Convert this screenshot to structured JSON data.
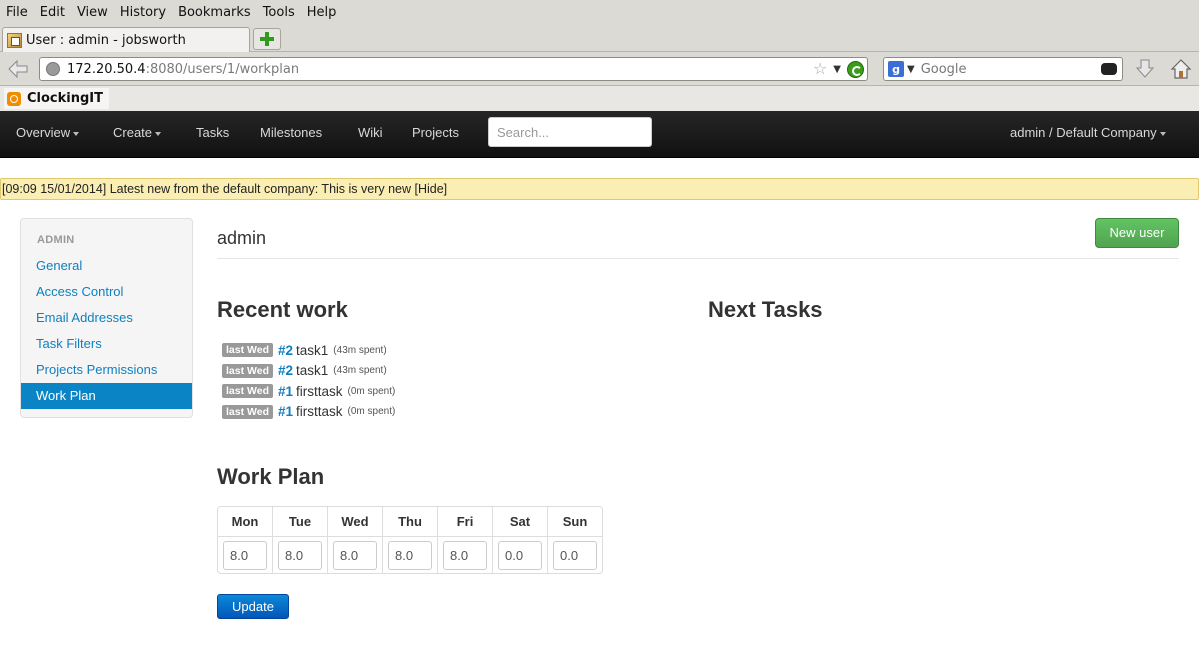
{
  "browser": {
    "menu": [
      "File",
      "Edit",
      "View",
      "History",
      "Bookmarks",
      "Tools",
      "Help"
    ],
    "tab_title": "User : admin - jobsworth",
    "url_host": "172.20.50.4",
    "url_rest": ":8080/users/1/workplan",
    "search_placeholder": "Google",
    "bookmark": "ClockingIT"
  },
  "nav": {
    "items": [
      "Overview",
      "Create",
      "Tasks",
      "Milestones",
      "Wiki",
      "Projects"
    ],
    "search_placeholder": "Search...",
    "user_menu": "admin / Default Company"
  },
  "notice": "[09:09 15/01/2014] Latest new from the default company: This is very new [Hide]",
  "sidebar": {
    "header": "ADMIN",
    "items": [
      "General",
      "Access Control",
      "Email Addresses",
      "Task Filters",
      "Projects Permissions",
      "Work Plan"
    ],
    "active": "Work Plan"
  },
  "page": {
    "title": "admin",
    "new_user_label": "New user",
    "recent_work_heading": "Recent work",
    "next_tasks_heading": "Next Tasks",
    "work_plan_heading": "Work Plan",
    "update_label": "Update"
  },
  "recent_work": [
    {
      "when": "last Wed",
      "id": "#2",
      "name": "task1",
      "spent": "(43m spent)"
    },
    {
      "when": "last Wed",
      "id": "#2",
      "name": "task1",
      "spent": "(43m spent)"
    },
    {
      "when": "last Wed",
      "id": "#1",
      "name": "firsttask",
      "spent": "(0m spent)"
    },
    {
      "when": "last Wed",
      "id": "#1",
      "name": "firsttask",
      "spent": "(0m spent)"
    }
  ],
  "work_plan": {
    "days": [
      "Mon",
      "Tue",
      "Wed",
      "Thu",
      "Fri",
      "Sat",
      "Sun"
    ],
    "hours": [
      "8.0",
      "8.0",
      "8.0",
      "8.0",
      "8.0",
      "0.0",
      "0.0"
    ]
  },
  "colors": {
    "link": "#0e7fc0",
    "active_sidebar": "#0a84c5",
    "new_user_button": "#5bb75b",
    "update_button": "#0866c6",
    "notice_bg": "#fbeeb3"
  }
}
